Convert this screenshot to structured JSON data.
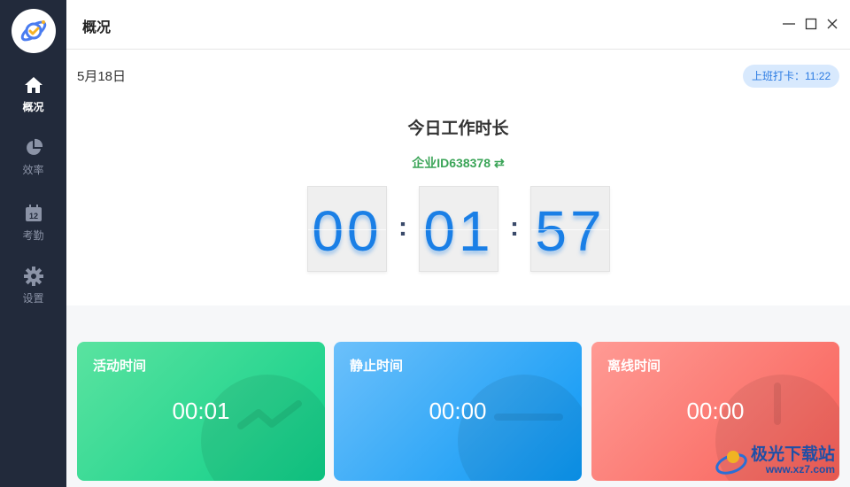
{
  "sidebar": {
    "logo_icon": "planet-check-logo",
    "items": [
      {
        "label": "概况",
        "icon": "home-icon",
        "active": true
      },
      {
        "label": "效率",
        "icon": "pie-chart-icon",
        "active": false
      },
      {
        "label": "考勤",
        "icon": "calendar-icon",
        "active": false
      },
      {
        "label": "设置",
        "icon": "gear-icon",
        "active": false
      }
    ]
  },
  "titlebar": {
    "title": "概况"
  },
  "header": {
    "date": "5月18日",
    "clock_in": "上班打卡：11:22"
  },
  "main": {
    "today_title": "今日工作时长",
    "company_id": "企业ID638378",
    "swap_icon": "⇄",
    "clock": {
      "hours": "00",
      "minutes": "01",
      "seconds": "57",
      "separator": ":"
    }
  },
  "cards": [
    {
      "title": "活动时间",
      "value": "00:01",
      "color": "#11cf89"
    },
    {
      "title": "静止时间",
      "value": "00:00",
      "color": "#0a97f4"
    },
    {
      "title": "离线时间",
      "value": "00:00",
      "color": "#f86058"
    }
  ],
  "watermark": {
    "text": "极光下载站",
    "url": "www.xz7.com"
  },
  "colors": {
    "sidebar_bg": "#222a3b",
    "accent_blue": "#1a7fe6",
    "accent_green": "#3aa457"
  }
}
